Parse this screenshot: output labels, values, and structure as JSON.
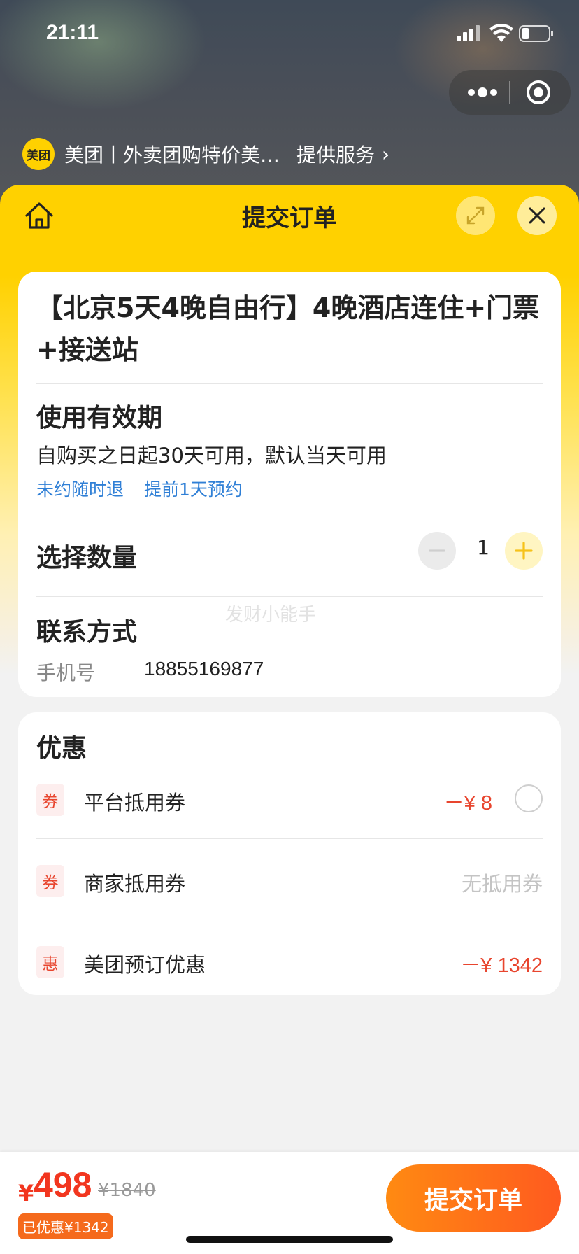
{
  "status_bar": {
    "time": "21:11"
  },
  "provider": {
    "logo_text": "美团",
    "name": "美团丨外卖团购特价美…",
    "service": "提供服务",
    "arrow": "›"
  },
  "sheet": {
    "title": "提交订单"
  },
  "product": {
    "title": "【北京5天4晚自由行】4晚酒店连住+门票+接送站"
  },
  "validity": {
    "heading": "使用有效期",
    "text": "自购买之日起30天可用，默认当天可用",
    "tags": [
      "未约随时退",
      "提前1天预约"
    ]
  },
  "quantity": {
    "heading": "选择数量",
    "value": "1"
  },
  "watermark": "发财小能手",
  "contact": {
    "heading": "联系方式",
    "phone_label": "手机号",
    "phone_value": "18855169877"
  },
  "discounts": {
    "heading": "优惠",
    "items": [
      {
        "badge": "券",
        "label": "平台抵用券",
        "value": "－¥ 8",
        "has_radio": true
      },
      {
        "badge": "券",
        "label": "商家抵用券",
        "value": "无抵用券"
      },
      {
        "badge": "惠",
        "label": "美团预订优惠",
        "value": "－¥ 1342"
      }
    ]
  },
  "footer": {
    "currency": "¥",
    "price": "498",
    "original_price": "¥1840",
    "saved": "已优惠¥1342",
    "submit_label": "提交订单"
  },
  "colors": {
    "brand_yellow": "#ffd100",
    "accent_red": "#f2361f",
    "link_blue": "#2f7fd6",
    "button_orange": "#ff6a1a"
  }
}
